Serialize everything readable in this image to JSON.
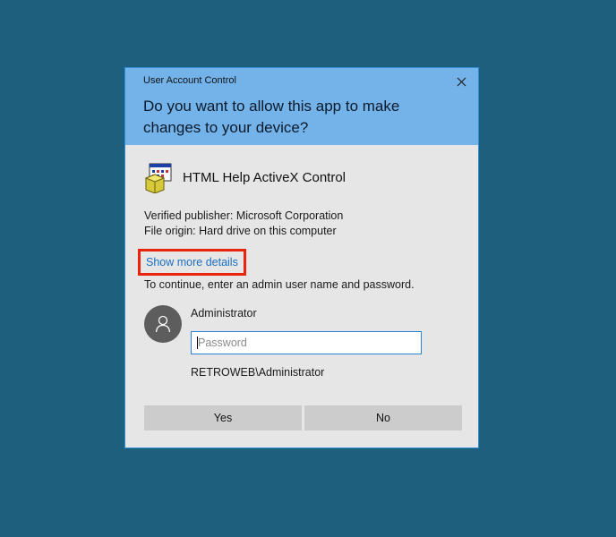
{
  "window": {
    "title": "User Account Control",
    "question": "Do you want to allow this app to make changes to your device?"
  },
  "app": {
    "name": "HTML Help ActiveX Control",
    "icon": "activex-control-icon"
  },
  "info": {
    "publisher": "Verified publisher: Microsoft Corporation",
    "origin": "File origin: Hard drive on this computer"
  },
  "details_link": "Show more details",
  "continue_text": "To continue, enter an admin user name and password.",
  "credentials": {
    "username": "Administrator",
    "password_placeholder": "Password",
    "password_value": "",
    "domain_user": "RETROWEB\\Administrator"
  },
  "buttons": {
    "yes": "Yes",
    "no": "No"
  },
  "colors": {
    "desktop": "#1f5f7e",
    "header": "#73b3ea",
    "highlight_box": "#e8240f",
    "link": "#1a6fc2"
  }
}
